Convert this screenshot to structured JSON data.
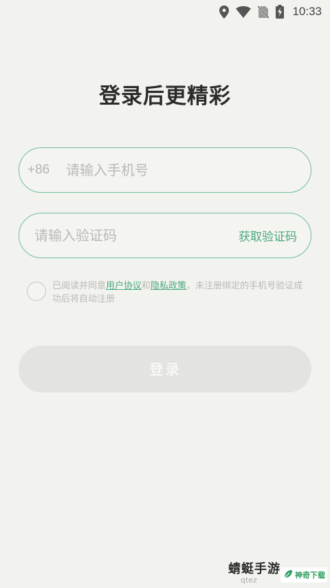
{
  "status_bar": {
    "time": "10:33",
    "icons": [
      "location-icon",
      "wifi-icon",
      "no-sim-icon",
      "battery-charging-icon"
    ]
  },
  "title": "登录后更精彩",
  "phone": {
    "prefix": "+86",
    "placeholder": "请输入手机号",
    "value": ""
  },
  "code": {
    "placeholder": "请输入验证码",
    "value": "",
    "get_code_label": "获取验证码"
  },
  "agreement": {
    "checked": false,
    "text_before": "已阅读并同意",
    "user_agreement": "用户协议",
    "and": "和",
    "privacy_policy": "隐私政策",
    "text_after": "，未注册绑定的手机号验证成功后将自动注册"
  },
  "login_button_label": "登录",
  "watermark": {
    "text": "蜻蜓手游",
    "url": "qtez",
    "badge": "神奇下载"
  },
  "colors": {
    "accent": "#4aa87f",
    "field_border": "#6dbf9e",
    "background": "#f2f2ee",
    "button_disabled": "#e3e3e0"
  }
}
